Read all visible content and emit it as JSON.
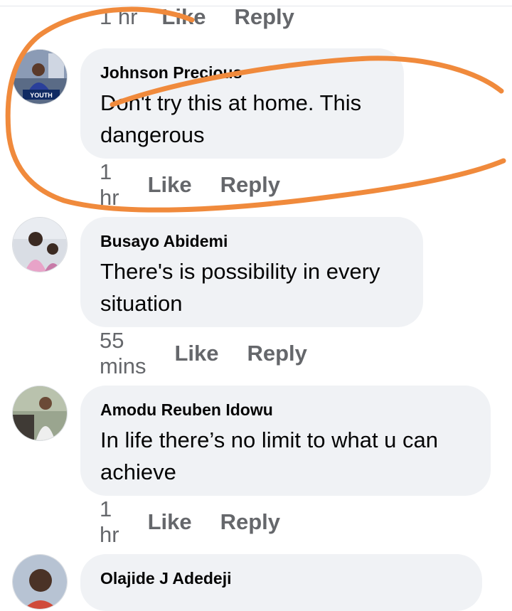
{
  "top_actions": {
    "time": "1 hr",
    "like": "Like",
    "reply": "Reply"
  },
  "comments": [
    {
      "author": "Johnson Precious",
      "text": "Don't try this at home. This dangerous",
      "time": "1 hr",
      "like": "Like",
      "reply": "Reply",
      "avatar_badge": "YOUTH"
    },
    {
      "author": "Busayo Abidemi",
      "text": "There's is possibility in every situation",
      "time": "55 mins",
      "like": "Like",
      "reply": "Reply"
    },
    {
      "author": "Amodu Reuben Idowu",
      "text": "In life there’s no limit to what u can achieve",
      "time": "1 hr",
      "like": "Like",
      "reply": "Reply"
    },
    {
      "author": "Olajide J Adedeji"
    }
  ],
  "colors": {
    "bubble": "#f0f2f5",
    "meta_text": "#65676b",
    "scribble": "#f08a3c"
  }
}
